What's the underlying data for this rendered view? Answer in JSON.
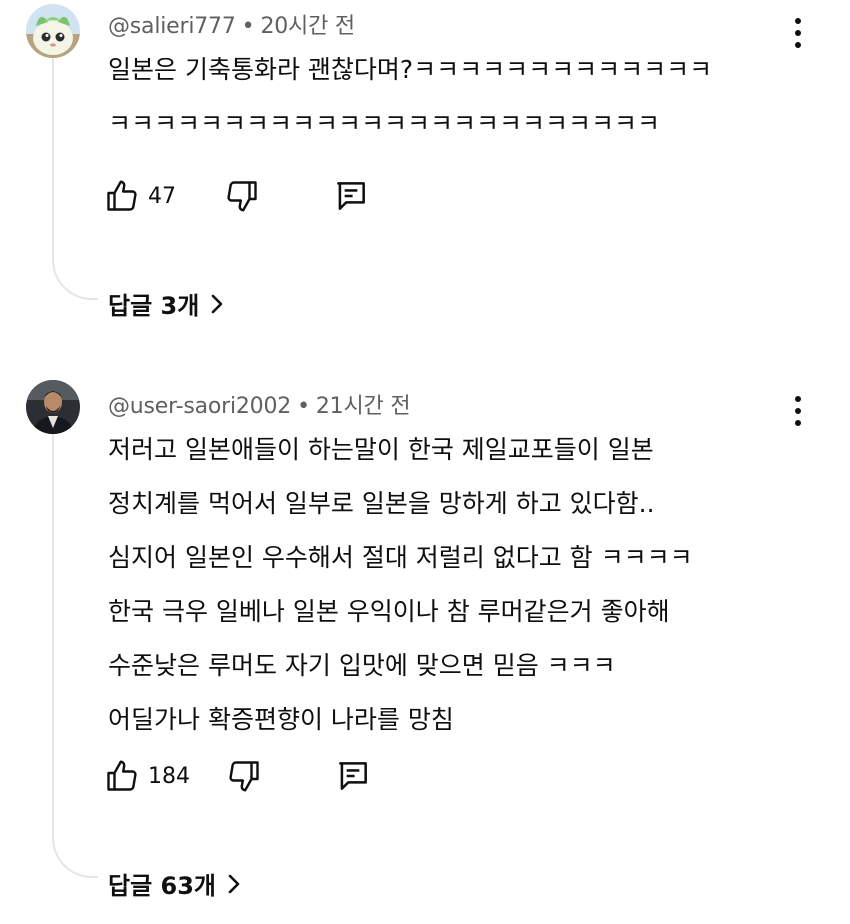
{
  "comments": [
    {
      "author": "@salieri777",
      "separator": "•",
      "time": "20시간 전",
      "lines": [
        "일본은 기축통화라 괜찮다며?ㅋㅋㅋㅋㅋㅋㅋㅋㅋㅋㅋㅋㅋ",
        "ㅋㅋㅋㅋㅋㅋㅋㅋㅋㅋㅋㅋㅋㅋㅋㅋㅋㅋㅋㅋㅋㅋㅋㅋ"
      ],
      "likes": "47",
      "replies_label": "답글 3개"
    },
    {
      "author": "@user-saori2002",
      "separator": "•",
      "time": "21시간 전",
      "lines": [
        "저러고 일본애들이 하는말이 한국 제일교포들이 일본",
        "정치계를 먹어서 일부로 일본을 망하게 하고 있다함..",
        "심지어 일본인 우수해서 절대 저럴리 없다고 함 ㅋㅋㅋㅋ",
        "한국 극우 일베나 일본 우익이나 참 루머같은거 좋아해",
        "수준낮은 루머도 자기 입맛에 맞으면 믿음 ㅋㅋㅋ",
        "어딜가나 확증편향이 나라를 망침"
      ],
      "likes": "184",
      "replies_label": "답글 63개"
    }
  ],
  "icons": {
    "like": "thumbs-up-icon",
    "dislike": "thumbs-down-icon",
    "reply": "comment-icon",
    "more": "more-vertical-icon",
    "chevron": "chevron-right-icon"
  },
  "colors": {
    "text": "#0f0f0f",
    "meta": "#606060",
    "thread_line": "#e5e5e5"
  }
}
